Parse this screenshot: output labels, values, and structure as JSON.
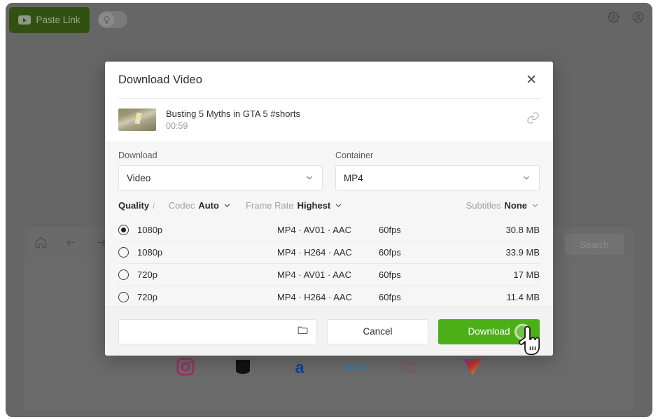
{
  "background_app": {
    "paste_link_button": "Paste Link",
    "paste_link_icon": "youtube-play-icon",
    "theme_toggle_icon": "lightbulb-icon",
    "settings_icon": "gear-icon",
    "account_icon": "user-circle-icon",
    "toolbar": {
      "home_icon": "home-icon",
      "back_icon": "arrow-left-icon",
      "forward_icon": "arrow-right-icon",
      "search_button": "Search"
    },
    "site_shortcuts": [
      {
        "name": "instagram",
        "label": ""
      },
      {
        "name": "dark-square",
        "label": ""
      },
      {
        "name": "letter-a",
        "label": ""
      },
      {
        "name": "bilibili",
        "label": "bilibili"
      },
      {
        "name": "adult-sites",
        "label_line1": "adult",
        "label_line2": "sites"
      },
      {
        "name": "colorful-heart",
        "label": ""
      }
    ]
  },
  "modal": {
    "title": "Download Video",
    "close_icon": "close-x-icon",
    "video": {
      "title": "Busting 5 Myths in GTA 5 #shorts",
      "duration": "00:59",
      "link_icon": "link-chain-icon",
      "thumbnail_icon": "video-thumbnail"
    },
    "fields": {
      "download": {
        "label": "Download",
        "value": "Video",
        "chevron": "chevron-down-icon"
      },
      "container": {
        "label": "Container",
        "value": "MP4",
        "chevron": "chevron-down-icon"
      }
    },
    "options": {
      "quality_label": "Quality",
      "quality_info_icon": "info-icon",
      "codec_label": "Codec",
      "codec_value": "Auto",
      "frame_rate_label": "Frame Rate",
      "frame_rate_value": "Highest",
      "subtitles_label": "Subtitles",
      "subtitles_value": "None"
    },
    "quality_rows": [
      {
        "resolution": "1080p",
        "codec": "MP4 · AV01 · AAC",
        "fps": "60fps",
        "size": "30.8 MB",
        "selected": true
      },
      {
        "resolution": "1080p",
        "codec": "MP4 · H264 · AAC",
        "fps": "60fps",
        "size": "33.9 MB",
        "selected": false
      },
      {
        "resolution": "720p",
        "codec": "MP4 · AV01 · AAC",
        "fps": "60fps",
        "size": "17 MB",
        "selected": false
      },
      {
        "resolution": "720p",
        "codec": "MP4 · H264 · AAC",
        "fps": "60fps",
        "size": "11.4 MB",
        "selected": false
      }
    ],
    "footer": {
      "path_value": "",
      "path_placeholder": "",
      "folder_icon": "folder-icon",
      "cancel_label": "Cancel",
      "download_label": "Download"
    }
  },
  "cursor": {
    "icon": "pointing-hand-cursor"
  },
  "colors": {
    "accent_green": "#4caf18",
    "paste_link_green": "#315113",
    "overlay_gray": "#666666",
    "modal_bg": "#ffffff",
    "panel_gray": "#f6f6f6"
  }
}
